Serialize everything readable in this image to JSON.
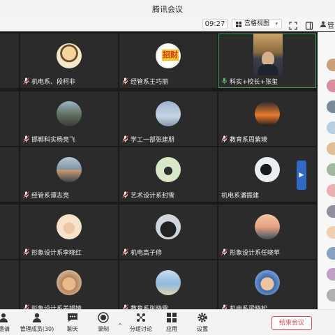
{
  "window": {
    "title": "腾讯会议"
  },
  "toolbar": {
    "timer": "09:27",
    "view_label": "宫格视图",
    "view_icon": "grid-icon",
    "caret": "▾",
    "manage_partial": "管"
  },
  "tiles": [
    {
      "name": "",
      "avatar": "none",
      "mic": "none"
    },
    {
      "name": "机电系、段柯非",
      "avatar": "cartoon-boy",
      "mic": "muted"
    },
    {
      "name": "经管系王巧丽",
      "avatar": "zhaocai-logo",
      "mic": "muted"
    },
    {
      "name": "科实+校长+张玺",
      "avatar": "video",
      "mic": "on"
    },
    {
      "name": "",
      "avatar": "none",
      "mic": "none"
    },
    {
      "name": "邯郸科实杨亮飞",
      "avatar": "family-photo",
      "mic": "muted"
    },
    {
      "name": "学工一部张建朋",
      "avatar": "sky",
      "mic": "muted"
    },
    {
      "name": "教育系周紫瑛",
      "avatar": "sunset",
      "mic": "muted"
    },
    {
      "name": "",
      "avatar": "none",
      "mic": "none"
    },
    {
      "name": "经管系谭志亮",
      "avatar": "sea",
      "mic": "muted"
    },
    {
      "name": "艺术设计系封雪",
      "avatar": "girl-cartoon",
      "mic": "muted"
    },
    {
      "name": "机电系潘振建",
      "avatar": "silhouette",
      "mic": "none"
    },
    {
      "name": "",
      "avatar": "none",
      "mic": "none"
    },
    {
      "name": "形象设计系李晓红",
      "avatar": "girl-sketch",
      "mic": "muted"
    },
    {
      "name": "机电高子修",
      "avatar": "hoodie",
      "mic": "muted"
    },
    {
      "name": "形象设计系任晓苹",
      "avatar": "dusk",
      "mic": "muted"
    },
    {
      "name": "",
      "avatar": "none",
      "mic": "none"
    },
    {
      "name": "形象设计系姜娟婧",
      "avatar": "dog",
      "mic": "muted"
    },
    {
      "name": "教育系张晓雪",
      "avatar": "beach",
      "mic": "muted"
    },
    {
      "name": "机电系梁晓松",
      "avatar": "glasses-man",
      "mic": "muted"
    }
  ],
  "bottombar": {
    "invite": "邀请",
    "members": "管理成员(30)",
    "chat": "聊天",
    "record": "录制",
    "breakout": "分组讨论",
    "apps": "应用",
    "settings": "设置",
    "end": "结束会议"
  },
  "colors": {
    "active_border": "#3aa15a",
    "end_red": "#e24a4a",
    "accent_blue": "#2f6bc6"
  }
}
